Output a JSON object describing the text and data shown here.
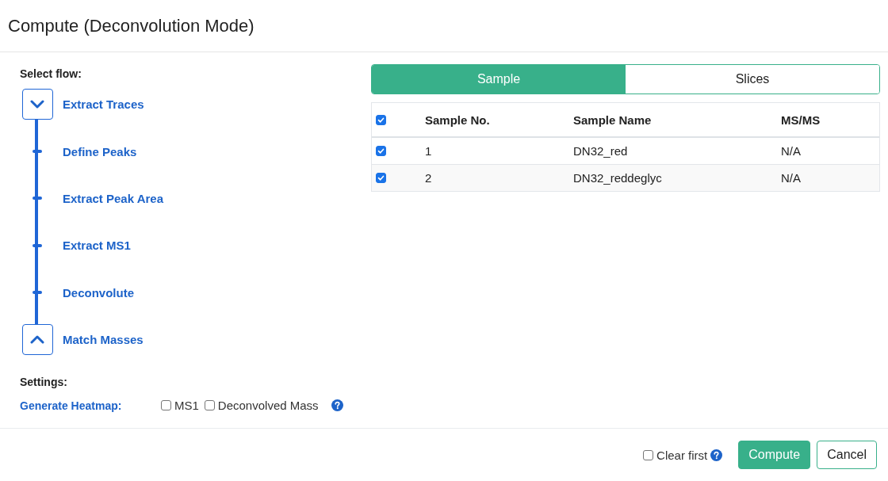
{
  "dialog": {
    "title": "Compute (Deconvolution Mode)"
  },
  "flow": {
    "label": "Select flow:",
    "steps": [
      {
        "label": "Extract Traces",
        "kind": "start"
      },
      {
        "label": "Define Peaks",
        "kind": "step"
      },
      {
        "label": "Extract Peak Area",
        "kind": "step"
      },
      {
        "label": "Extract MS1",
        "kind": "step"
      },
      {
        "label": "Deconvolute",
        "kind": "step"
      },
      {
        "label": "Match Masses",
        "kind": "end"
      }
    ]
  },
  "settings": {
    "label": "Settings:",
    "heatmap": {
      "label": "Generate Heatmap:",
      "options": [
        {
          "label": "MS1",
          "checked": false
        },
        {
          "label": "Deconvolved Mass",
          "checked": false
        }
      ]
    }
  },
  "tabs": [
    {
      "label": "Sample",
      "selected": true
    },
    {
      "label": "Slices",
      "selected": false
    }
  ],
  "table": {
    "select_all_checked": true,
    "columns": [
      "Sample No.",
      "Sample Name",
      "MS/MS"
    ],
    "rows": [
      {
        "checked": true,
        "cells": [
          "1",
          "DN32_red",
          "N/A"
        ]
      },
      {
        "checked": true,
        "cells": [
          "2",
          "DN32_reddeglyc",
          "N/A"
        ]
      }
    ]
  },
  "footer": {
    "clear_first": {
      "label": "Clear first",
      "checked": false
    },
    "buttons": [
      {
        "label": "Compute",
        "kind": "primary"
      },
      {
        "label": "Cancel",
        "kind": "secondary"
      }
    ]
  }
}
